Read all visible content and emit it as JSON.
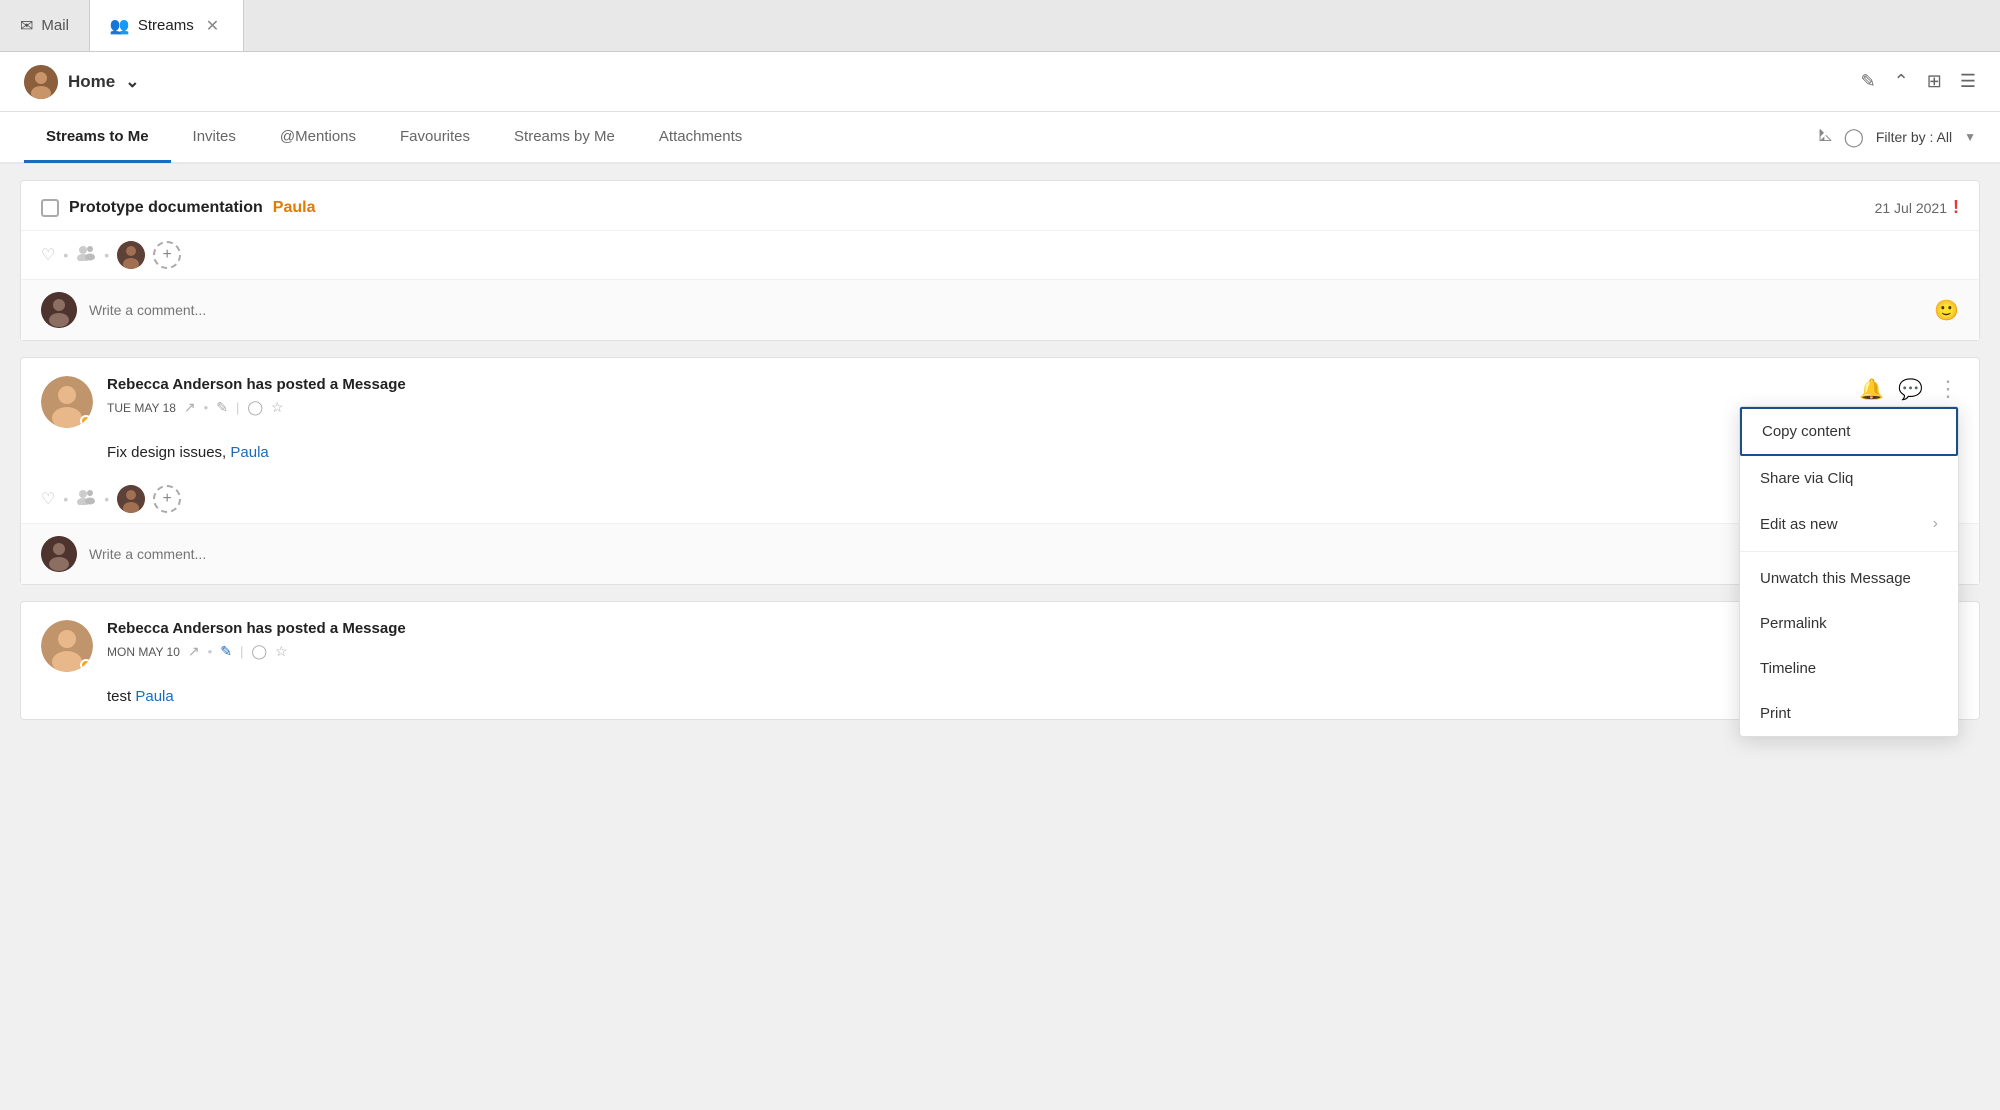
{
  "tabs": [
    {
      "id": "mail",
      "label": "Mail",
      "icon": "✉",
      "active": false
    },
    {
      "id": "streams",
      "label": "Streams",
      "icon": "👥",
      "active": true
    }
  ],
  "header": {
    "home_label": "Home",
    "chevron": "∨"
  },
  "nav_tabs": [
    {
      "id": "streams-to-me",
      "label": "Streams to Me",
      "active": true
    },
    {
      "id": "invites",
      "label": "Invites",
      "active": false
    },
    {
      "id": "mentions",
      "label": "@Mentions",
      "active": false
    },
    {
      "id": "favourites",
      "label": "Favourites",
      "active": false
    },
    {
      "id": "streams-by-me",
      "label": "Streams by Me",
      "active": false
    },
    {
      "id": "attachments",
      "label": "Attachments",
      "active": false
    }
  ],
  "filter": {
    "label": "Filter by : All"
  },
  "prototype_card": {
    "title": "Prototype documentation",
    "title_highlight": "Paula",
    "date": "21 Jul 2021",
    "urgent": "!",
    "comment_placeholder": "Write a comment..."
  },
  "post1": {
    "author": "Rebecca Anderson has posted a Message",
    "date": "TUE MAY 18",
    "body_text": "Fix design issues,",
    "body_mention": "Paula",
    "comment_placeholder": "Write a comment..."
  },
  "post2": {
    "author": "Rebecca Anderson has posted a Message",
    "date": "MON MAY 10",
    "body_text": "test",
    "body_mention": "Paula",
    "comment_placeholder": "Write a comment..."
  },
  "context_menu": {
    "items": [
      {
        "id": "copy-content",
        "label": "Copy content",
        "active": true
      },
      {
        "id": "share-via-cliq",
        "label": "Share via Cliq",
        "active": false
      },
      {
        "id": "edit-as-new",
        "label": "Edit as new",
        "has_arrow": true,
        "active": false
      },
      {
        "id": "divider1",
        "divider": true
      },
      {
        "id": "unwatch",
        "label": "Unwatch this Message",
        "active": false
      },
      {
        "id": "permalink",
        "label": "Permalink",
        "active": false
      },
      {
        "id": "timeline",
        "label": "Timeline",
        "active": false
      },
      {
        "id": "print",
        "label": "Print",
        "active": false
      }
    ]
  },
  "icons": {
    "edit": "✏",
    "collapse": "⌃",
    "grid": "⊞",
    "menu": "☰",
    "filter": "⧩",
    "funnel": "⊿",
    "bell": "🔔",
    "chat": "💬",
    "more": "⋮",
    "heart": "♡",
    "people": "👥",
    "link": "↗",
    "edit2": "✎",
    "shield": "◯",
    "star": "☆",
    "emoji": "😊"
  }
}
